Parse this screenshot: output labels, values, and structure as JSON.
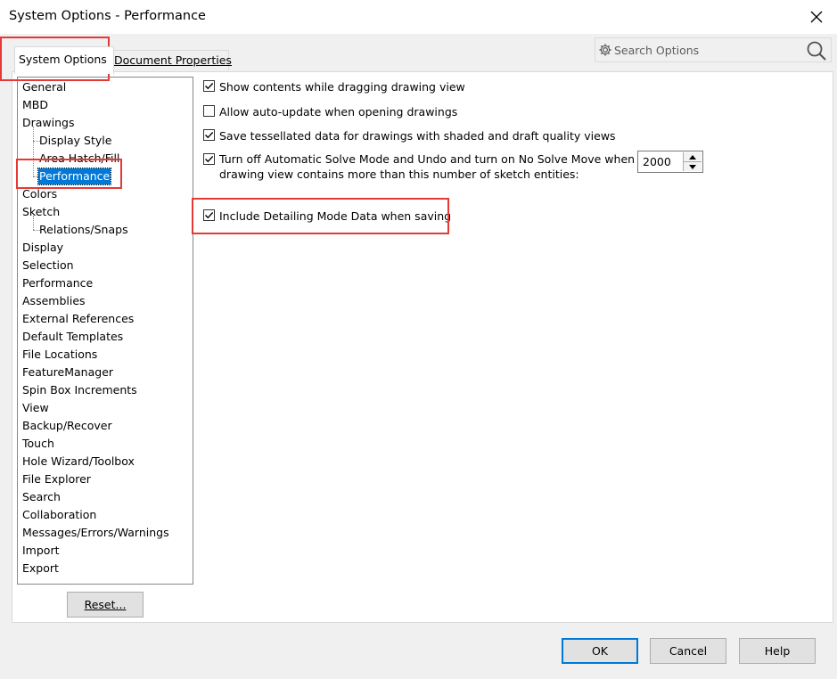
{
  "window": {
    "title": "System Options - Performance"
  },
  "tabs": [
    {
      "label": "System Options",
      "active": true
    },
    {
      "label": "Document Properties",
      "active": false
    }
  ],
  "search": {
    "placeholder": "Search Options"
  },
  "tree": {
    "items": [
      {
        "label": "General",
        "indent": 0
      },
      {
        "label": "MBD",
        "indent": 0
      },
      {
        "label": "Drawings",
        "indent": 0
      },
      {
        "label": "Display Style",
        "indent": 1
      },
      {
        "label": "Area Hatch/Fill",
        "indent": 1
      },
      {
        "label": "Performance",
        "indent": 1,
        "selected": true
      },
      {
        "label": "Colors",
        "indent": 0
      },
      {
        "label": "Sketch",
        "indent": 0
      },
      {
        "label": "Relations/Snaps",
        "indent": 1
      },
      {
        "label": "Display",
        "indent": 0
      },
      {
        "label": "Selection",
        "indent": 0
      },
      {
        "label": "Performance",
        "indent": 0
      },
      {
        "label": "Assemblies",
        "indent": 0
      },
      {
        "label": "External References",
        "indent": 0
      },
      {
        "label": "Default Templates",
        "indent": 0
      },
      {
        "label": "File Locations",
        "indent": 0
      },
      {
        "label": "FeatureManager",
        "indent": 0
      },
      {
        "label": "Spin Box Increments",
        "indent": 0
      },
      {
        "label": "View",
        "indent": 0
      },
      {
        "label": "Backup/Recover",
        "indent": 0
      },
      {
        "label": "Touch",
        "indent": 0
      },
      {
        "label": "Hole Wizard/Toolbox",
        "indent": 0
      },
      {
        "label": "File Explorer",
        "indent": 0
      },
      {
        "label": "Search",
        "indent": 0
      },
      {
        "label": "Collaboration",
        "indent": 0
      },
      {
        "label": "Messages/Errors/Warnings",
        "indent": 0
      },
      {
        "label": "Import",
        "indent": 0
      },
      {
        "label": "Export",
        "indent": 0
      }
    ]
  },
  "options": {
    "show_contents": {
      "label": "Show contents while dragging drawing view",
      "checked": true
    },
    "auto_update": {
      "label": "Allow auto-update when opening drawings",
      "checked": false
    },
    "save_tessellated": {
      "label": "Save tessellated data for drawings with shaded and draft quality views",
      "checked": true
    },
    "turn_off_solve": {
      "label_line1": "Turn off Automatic Solve Mode and Undo and turn on No Solve Move when",
      "label_line2": "drawing view contains more than this number of sketch entities:",
      "checked": true,
      "value": "2000"
    },
    "include_detailing": {
      "label": "Include Detailing Mode Data when saving",
      "checked": true
    }
  },
  "buttons": {
    "reset": "Reset...",
    "ok": "OK",
    "cancel": "Cancel",
    "help": "Help"
  },
  "colors": {
    "selection": "#0078d7",
    "highlight": "#e53935"
  }
}
